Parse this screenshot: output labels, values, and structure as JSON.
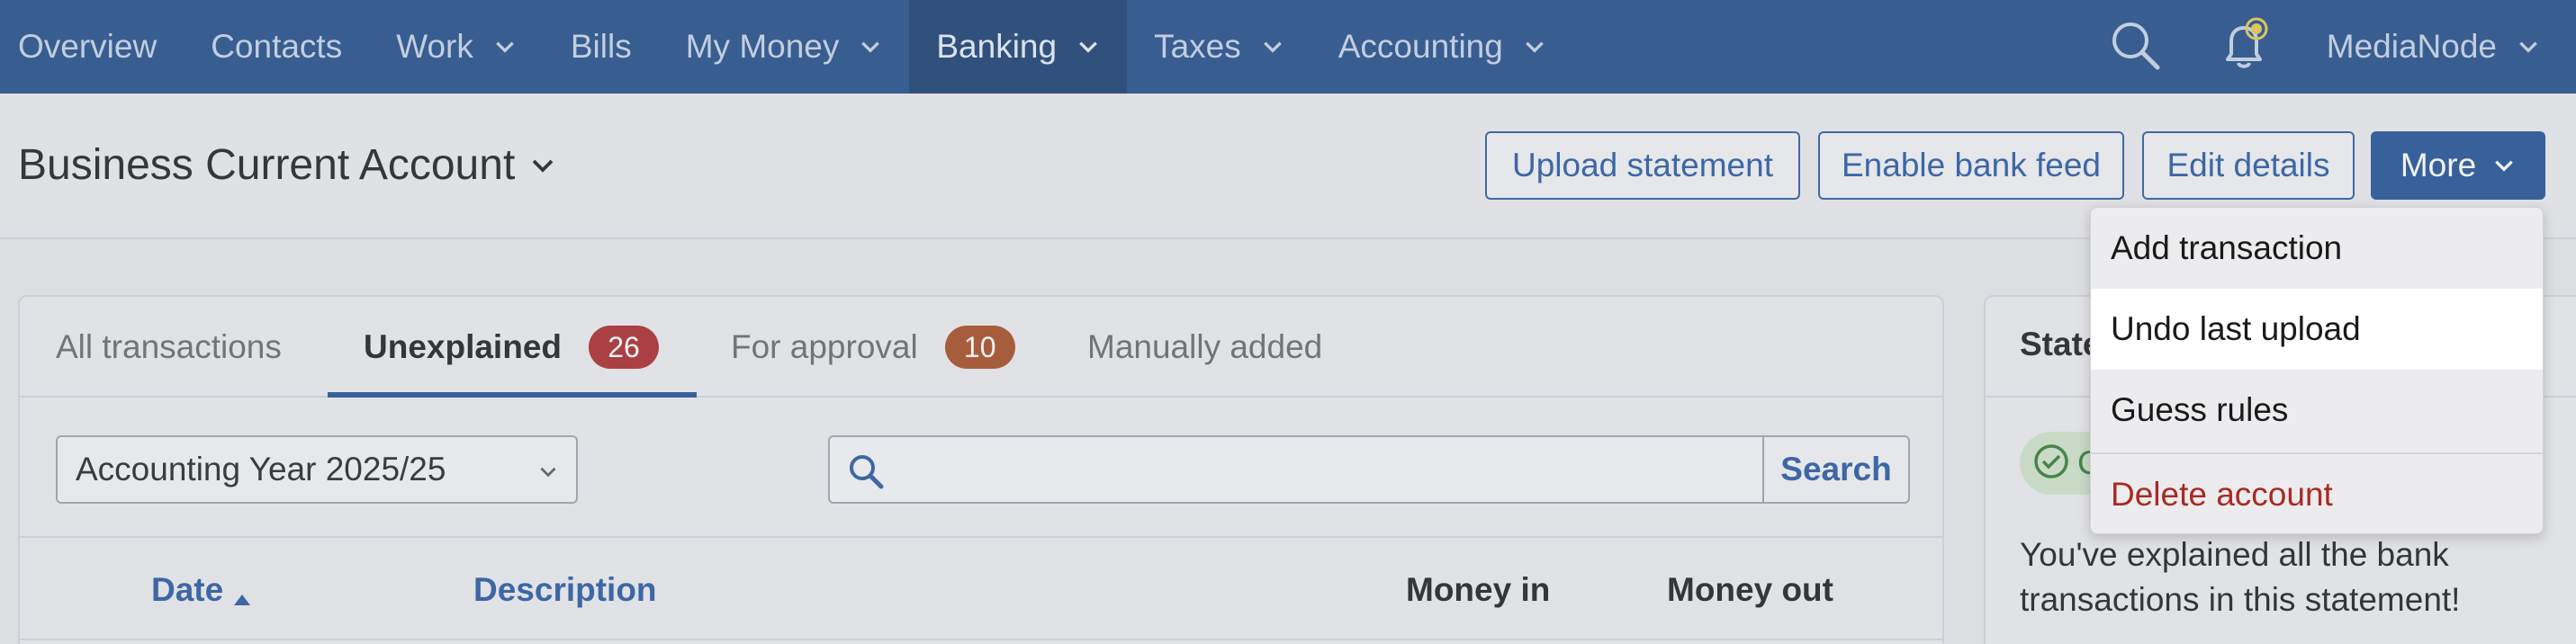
{
  "nav": {
    "items": [
      {
        "label": "Overview",
        "dropdown": false
      },
      {
        "label": "Contacts",
        "dropdown": false
      },
      {
        "label": "Work",
        "dropdown": true
      },
      {
        "label": "Bills",
        "dropdown": false
      },
      {
        "label": "My Money",
        "dropdown": true
      },
      {
        "label": "Banking",
        "dropdown": true,
        "active": true
      },
      {
        "label": "Taxes",
        "dropdown": true
      },
      {
        "label": "Accounting",
        "dropdown": true
      }
    ],
    "search_icon": "search-icon",
    "bell_icon": "bell-icon",
    "user": "MediaNode"
  },
  "header": {
    "title": "Business Current Account",
    "buttons": {
      "upload": "Upload statement",
      "bank_feed": "Enable bank feed",
      "edit": "Edit details",
      "more": "More"
    }
  },
  "tabs": [
    {
      "label": "All transactions"
    },
    {
      "label": "Unexplained",
      "count": "26"
    },
    {
      "label": "For approval",
      "count": "10"
    },
    {
      "label": "Manually added"
    }
  ],
  "filters": {
    "year_select": "Accounting Year 2025/25",
    "search_placeholder": "",
    "search_button": "Search"
  },
  "table": {
    "columns": {
      "date": "Date",
      "description": "Description",
      "money_in": "Money in",
      "money_out": "Money out"
    }
  },
  "side_panel": {
    "title": "State",
    "pill_text": "C",
    "message": "You've explained all the bank transactions in this statement!"
  },
  "more_menu": {
    "items": {
      "add": "Add transaction",
      "undo": "Undo last upload",
      "guess": "Guess rules",
      "delete": "Delete account"
    }
  },
  "colors": {
    "nav_bg": "#1e4a88",
    "accent": "#1e4f94",
    "badge_red": "#a9272a",
    "badge_orange": "#a54a1f",
    "danger": "#a82a22"
  }
}
